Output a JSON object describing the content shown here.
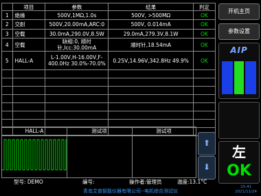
{
  "table": {
    "headers": [
      "",
      "项目",
      "参数",
      "结果",
      "判定"
    ],
    "rows": [
      {
        "idx": "1",
        "item": "绝缘",
        "param": "500V,1MΩ,1.0s",
        "result": "500V, >500MΩ",
        "verdict": "OK"
      },
      {
        "idx": "2",
        "item": "交耐",
        "param": "500V,20.00mA,ARC:0",
        "result": "500V, 0.014mA",
        "verdict": "OK"
      },
      {
        "idx": "3",
        "item": "空载",
        "param": "30.0mA,290.0V,8.5W",
        "result": "29.0mA,279.3V,8.1W",
        "verdict": "OK"
      },
      {
        "idx": "4",
        "item": "空载",
        "param": "缺相:0, 顺时针,Icc:30.00mA",
        "result": "顺时针,18.54mA",
        "verdict": "OK"
      },
      {
        "idx": "5",
        "item": "HALL-A",
        "param": "L-1.00V,H-16.00V,F-400.0Hz 30.0%-70.0%",
        "result": "0.25V,14.96V,342.8Hz 49.9%",
        "verdict": "OK"
      }
    ]
  },
  "wave": {
    "title": "HALL-A",
    "col2": "测试项",
    "col3": "测试项",
    "up_icon": "arrow-up-icon",
    "down_icon": "arrow-down-icon"
  },
  "status": {
    "model": "型号: DEMO",
    "serial": "编号:",
    "operator": "操作者:管理员",
    "temp": "温度:13.1°C"
  },
  "footer": "青岛艾普智能仪器有限公司--电机综合测试仪",
  "clock": {
    "time": "15:41",
    "date": "2021/11/24"
  },
  "side": {
    "start_label": "开机主页",
    "settings_label": "参数设置",
    "logo": "AIP",
    "dir_label": "左",
    "ok_label": "OK"
  },
  "colors": {
    "ok": "#00e000",
    "accent": "#3399ff"
  }
}
